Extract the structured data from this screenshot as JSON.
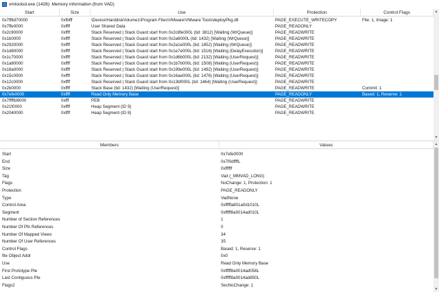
{
  "window": {
    "title": "vmtoolsd.exe (1428): Memory information (from VAD)"
  },
  "regions_table": {
    "columns": [
      "Start",
      "Size",
      "Use",
      "Protection",
      "Control Flags"
    ],
    "rows": [
      [
        "0x7ff8d70000",
        "0xfbfff",
        "\\Device\\HarddiskVolume1\\Program Files\\VMware\\VMware Tools\\deployPkg.dll",
        "PAGE_EXECUTE_WRITECOPY",
        "File: 1, Image: 1"
      ],
      [
        "0x7ffe0000",
        "0xffff",
        "User Shared Data",
        "PAGE_READONLY",
        ""
      ],
      [
        "0x2c90000",
        "0xffff",
        "Stack Reserved | Stack Guard start from 0x2c8fe000L (tid: 3812) [Waiting (WrQueue)]",
        "PAGE_READWRITE",
        ""
      ],
      [
        "0x1b0000",
        "0xffff",
        "Stack Reserved | Stack Guard start from 0x2a6000L (tid: 1432) [Waiting (WrQueue)]",
        "PAGE_READWRITE",
        ""
      ],
      [
        "0x2920000",
        "0xffff",
        "Stack Reserved | Stack Guard start from 0x2a1e000L (tid: 1852) [Waiting (WrQueue)]",
        "PAGE_READWRITE",
        ""
      ],
      [
        "0x1d80000",
        "0xffff",
        "Stack Reserved | Stack Guard start from 0x1e7e000L (tid: 1516) [Waiting (DelayExecution)]",
        "PAGE_READWRITE",
        ""
      ],
      [
        "0x1c70000",
        "0xffff",
        "Stack Reserved | Stack Guard start from 0x1d6b000L (tid: 2132) [Waiting (UserRequest)]",
        "PAGE_READWRITE",
        ""
      ],
      [
        "0x1a80000",
        "0xffff",
        "Stack Reserved | Stack Guard start from 0x1b7b000L (tid: 1508) [Waiting (UserRequest)]",
        "PAGE_READWRITE",
        ""
      ],
      [
        "0x18a0000",
        "0xffff",
        "Stack Reserved | Stack Guard start from 0x199e000L (tid: 1492) [Waiting (UserRequest)]",
        "PAGE_READWRITE",
        ""
      ],
      [
        "0x15c0000",
        "0xffff",
        "Stack Reserved | Stack Guard start from 0x16ae000L (tid: 1476) [Waiting (UserRequest)]",
        "PAGE_READWRITE",
        ""
      ],
      [
        "0x12c0000",
        "0xffff",
        "Stack Reserved | Stack Guard start from 0x13bf000L (tid: 1464) [Waiting (UserRequest)]",
        "PAGE_READWRITE",
        ""
      ],
      [
        "0x2b0000",
        "0xffff",
        "Stack Base (tid: 1432) [Waiting (UserRequest)]",
        "PAGE_READWRITE",
        "Commit: 1"
      ],
      [
        "0x7efe0000",
        "0xffff",
        "Read Only Memory Base",
        "PAGE_READONLY",
        "Based: 1, Reserve: 1"
      ],
      [
        "0x7fffffd8000",
        "0xfff",
        "PEB",
        "PAGE_READWRITE",
        ""
      ],
      [
        "0x21f0000",
        "0xffff",
        "Heap Segment (ID 9)",
        "PAGE_READWRITE",
        ""
      ],
      [
        "0x2040000",
        "0xffff",
        "Heap Segment (ID 8)",
        "PAGE_READWRITE",
        ""
      ]
    ],
    "selected_row_index": 12
  },
  "details_table": {
    "columns": [
      "Members",
      "Values"
    ],
    "rows": [
      [
        "Start",
        "0x7efe0000"
      ],
      [
        "End",
        "0x7f0dffffL"
      ],
      [
        "Size",
        "0xffffff"
      ],
      [
        "Tag",
        "Vad (_MMVAD_LONG)"
      ],
      [
        "Flags",
        "NoChange: 1, Protection: 1"
      ],
      [
        "Protection",
        "PAGE_READONLY"
      ],
      [
        "Type",
        "VadNone"
      ],
      [
        "Control Area",
        "0xfffffa801a0d1010L"
      ],
      [
        "Segment",
        "0xfffff8a0014ad010L"
      ],
      [
        "Number of Section References",
        "1"
      ],
      [
        "Number Of Pfn References",
        "0"
      ],
      [
        "Number Of Mapped Views",
        "34"
      ],
      [
        "Number Of User References",
        "35"
      ],
      [
        "Control Flags",
        "Based: 1, Reserve: 1"
      ],
      [
        "file Object Addr",
        "0x0"
      ],
      [
        "Use",
        "Read Only Memory Base"
      ],
      [
        "First Prototype Pte",
        "0xfffff8a0014ad058L"
      ],
      [
        "Last Contiguous Pte",
        "0xfffff8a0014ad850L"
      ],
      [
        "Flags2",
        "SecNoChange: 1"
      ]
    ]
  },
  "icons": {
    "app": "app-window-icon",
    "scroll_up": "scroll-up-arrow-icon",
    "scroll_down": "scroll-down-arrow-icon"
  },
  "colors": {
    "selection": "#0078d7",
    "selection_text": "#ffffff",
    "header_border": "#d9d9d9",
    "scrollbar_track": "#f0f0f0",
    "scrollbar_thumb": "#c2c2c2"
  }
}
